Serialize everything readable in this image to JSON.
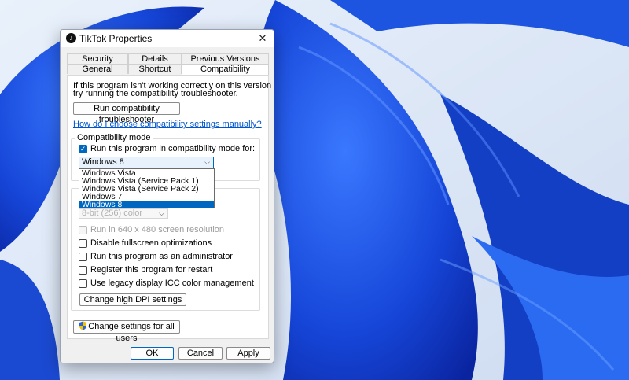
{
  "window": {
    "title": "TikTok Properties",
    "close_glyph": "✕"
  },
  "tabs": {
    "row1": [
      "Security",
      "Details",
      "Previous Versions"
    ],
    "row2": [
      "General",
      "Shortcut",
      "Compatibility"
    ],
    "active": "Compatibility"
  },
  "intro": {
    "line1": "If this program isn't working correctly on this version of Windows,",
    "line2": "try running the compatibility troubleshooter."
  },
  "buttons": {
    "troubleshooter": "Run compatibility troubleshooter",
    "change_dpi": "Change high DPI settings",
    "change_all_users": "Change settings for all users",
    "ok": "OK",
    "cancel": "Cancel",
    "apply": "Apply"
  },
  "link_manual": "How do I choose compatibility settings manually?",
  "compat_mode": {
    "group_label": "Compatibility mode",
    "checkbox_label": "Run this program in compatibility mode for:",
    "checked": true,
    "selected": "Windows 8",
    "options": [
      "Windows Vista",
      "Windows Vista (Service Pack 1)",
      "Windows Vista (Service Pack 2)",
      "Windows 7",
      "Windows 8"
    ]
  },
  "settings": {
    "reduced_color_value": "8-bit (256) color",
    "run_640": "Run in 640 x 480 screen resolution",
    "disable_fullscreen": "Disable fullscreen optimizations",
    "run_admin": "Run this program as an administrator",
    "register_restart": "Register this program for restart",
    "legacy_icc": "Use legacy display ICC color management"
  },
  "icons": {
    "app": "tiktok-icon",
    "close": "close-icon",
    "dropdown": "chevron-down-icon",
    "admin": "uac-shield-icon",
    "check": "checkmark-icon"
  },
  "colors": {
    "accent": "#0067c0",
    "link": "#0055cc",
    "wallpaper_blue": "#1a4fd6"
  }
}
